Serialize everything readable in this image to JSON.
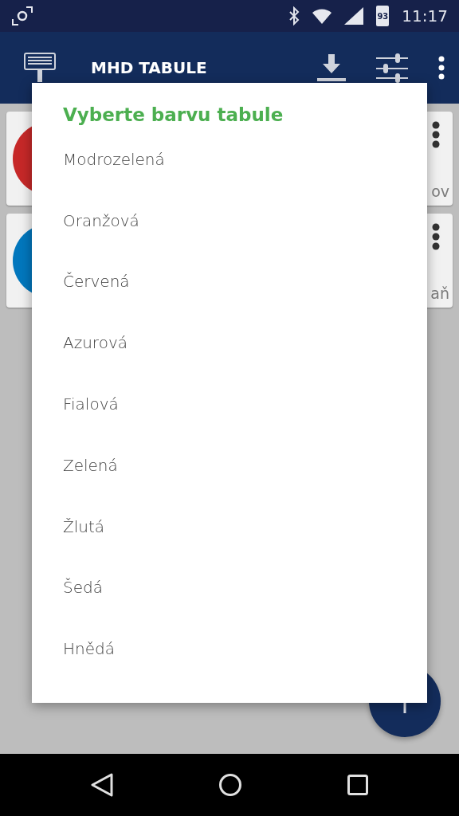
{
  "status_bar": {
    "battery": "93",
    "time": "11:17"
  },
  "app_bar": {
    "title": "MHD TABULE"
  },
  "cards": [
    {
      "color": "#c62828",
      "text": "ov"
    },
    {
      "color": "#0277bd",
      "text": "aň"
    }
  ],
  "dialog": {
    "title": "Vyberte barvu tabule",
    "options": [
      "Modrozelená",
      "Oranžová",
      "Červená",
      "Azurová",
      "Fialová",
      "Zelená",
      "Žlutá",
      "Šedá",
      "Hnědá"
    ]
  }
}
